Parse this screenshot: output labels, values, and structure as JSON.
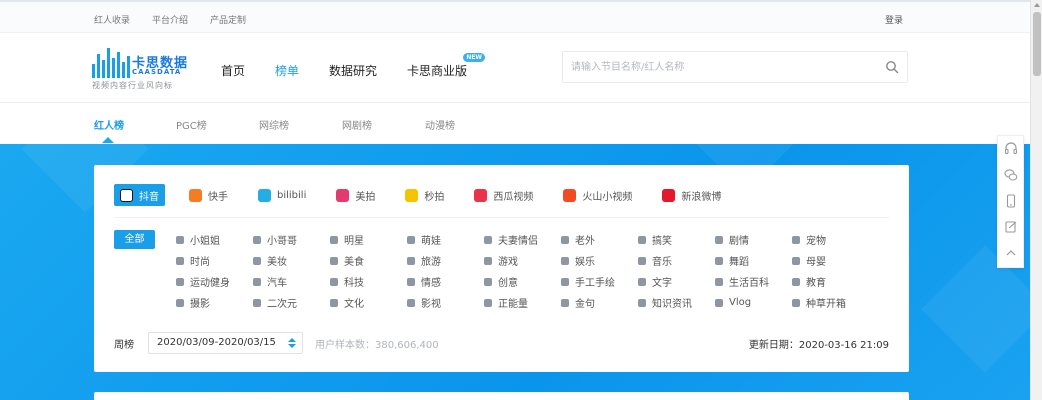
{
  "topbar": {
    "links": [
      "红人收录",
      "平台介绍",
      "产品定制"
    ],
    "login": "登录"
  },
  "logo": {
    "name": "卡思数据",
    "name_en": "CAASDATA",
    "slogan": "视频内容行业风向标"
  },
  "nav": {
    "items": [
      {
        "label": "首页",
        "active": false
      },
      {
        "label": "榜单",
        "active": true
      },
      {
        "label": "数据研究",
        "active": false
      },
      {
        "label": "卡思商业版",
        "active": false,
        "badge": "NEW"
      }
    ]
  },
  "search": {
    "placeholder": "请输入节目名称/红人名称",
    "icon": "search-icon"
  },
  "subtabs": [
    "红人榜",
    "PGC榜",
    "网综榜",
    "网剧榜",
    "动漫榜"
  ],
  "platforms": [
    {
      "label": "抖音",
      "icon": "douyin-icon",
      "color": "#111111",
      "active": true
    },
    {
      "label": "快手",
      "icon": "kuaishou-icon",
      "color": "#f47c22",
      "active": false
    },
    {
      "label": "bilibili",
      "icon": "bilibili-icon",
      "color": "#23ade5",
      "active": false
    },
    {
      "label": "美拍",
      "icon": "meipai-icon",
      "color": "#e23b6e",
      "active": false
    },
    {
      "label": "秒拍",
      "icon": "miaopai-icon",
      "color": "#f5c400",
      "active": false
    },
    {
      "label": "西瓜视频",
      "icon": "xigua-icon",
      "color": "#e8334a",
      "active": false
    },
    {
      "label": "火山小视频",
      "icon": "huoshan-icon",
      "color": "#f04b23",
      "active": false
    },
    {
      "label": "新浪微博",
      "icon": "weibo-icon",
      "color": "#e6162d",
      "active": false
    }
  ],
  "categories": {
    "all_label": "全部",
    "items": [
      "小姐姐",
      "小哥哥",
      "明星",
      "萌娃",
      "夫妻情侣",
      "老外",
      "搞笑",
      "剧情",
      "宠物",
      "时尚",
      "美妆",
      "美食",
      "旅游",
      "游戏",
      "娱乐",
      "音乐",
      "舞蹈",
      "母婴",
      "运动健身",
      "汽车",
      "科技",
      "情感",
      "创意",
      "手工手绘",
      "文字",
      "生活百科",
      "教育",
      "摄影",
      "二次元",
      "文化",
      "影视",
      "正能量",
      "金句",
      "知识资讯",
      "Vlog",
      "种草开箱"
    ]
  },
  "period": {
    "label": "周榜",
    "selected": "2020/03/09-2020/03/15",
    "sample_text": "用户样本数：380,606,400"
  },
  "updated": "更新日期：2020-03-16 21:09",
  "floatbar": [
    "headset-icon",
    "wechat-icon",
    "mobile-icon",
    "edit-icon",
    "back-to-top-icon"
  ]
}
